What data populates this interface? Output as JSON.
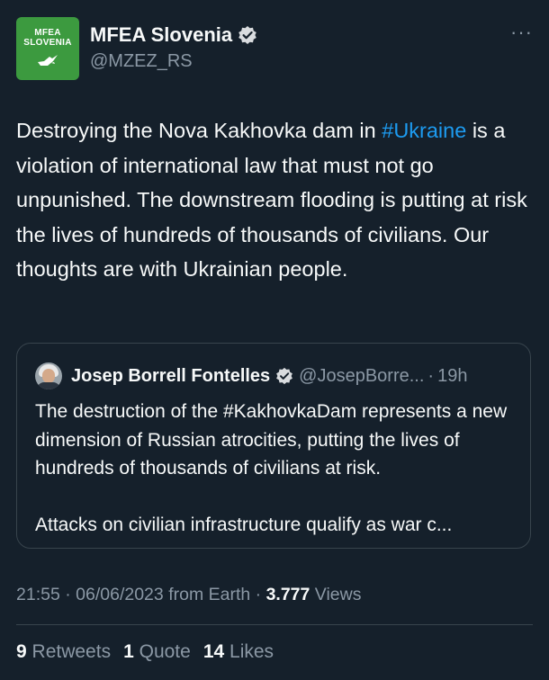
{
  "author": {
    "avatar_line1": "MFEA",
    "avatar_line2": "SLOVENIA",
    "display_name": "MFEA Slovenia",
    "handle": "@MZEZ_RS",
    "verified": true,
    "avatar_color": "#3c9a3f"
  },
  "more_label": "···",
  "tweet": {
    "text_before": "Destroying the Nova Kakhovka dam in ",
    "hashtag": "#Ukraine",
    "text_after": " is a violation of international law that must not go unpunished. The downstream flooding is putting at risk the lives of hundreds of thousands of civilians. Our thoughts are with Ukrainian people."
  },
  "quote": {
    "display_name": "Josep Borrell Fontelles",
    "handle": "@JosepBorre...",
    "separator": "·",
    "time": "19h",
    "paragraph1": "The destruction of the #KakhovkaDam represents a new dimension of Russian atrocities, putting the lives of hundreds of thousands of civilians at risk.",
    "paragraph2": "Attacks on civilian infrastructure qualify as war c..."
  },
  "meta": {
    "time": "21:55",
    "sep1": "·",
    "date": "06/06/2023",
    "source": "from Earth",
    "sep2": "·",
    "views_count": "3.777",
    "views_label": "Views"
  },
  "stats": {
    "retweets_count": "9",
    "retweets_label": "Retweets",
    "quotes_count": "1",
    "quotes_label": "Quote",
    "likes_count": "14",
    "likes_label": "Likes"
  },
  "colors": {
    "background": "#15202b",
    "text": "#f7f9f9",
    "secondary": "#8b98a5",
    "accent": "#1d9bf0",
    "border": "#38444d"
  },
  "icons": {
    "verified": "verified-badge-icon",
    "avatar_bird": "dove-icon",
    "more": "more-horizontal-icon"
  }
}
